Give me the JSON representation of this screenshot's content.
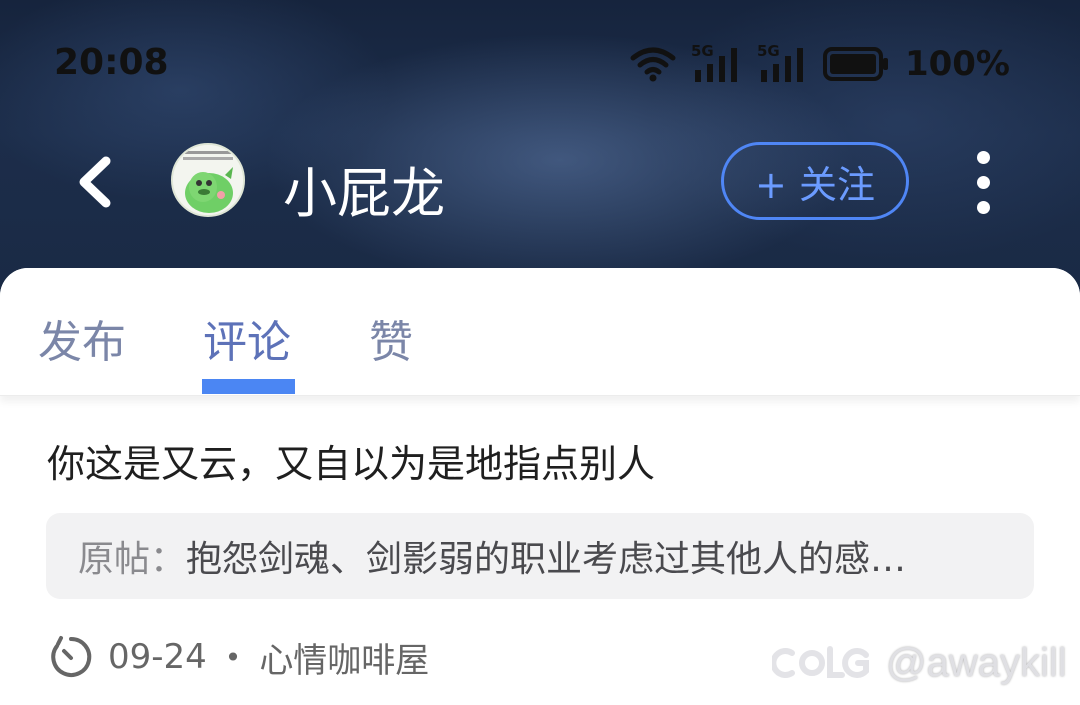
{
  "status_bar": {
    "time": "20:08",
    "network_1": "5G",
    "network_2": "5G",
    "battery": "100%"
  },
  "header": {
    "username": "小屁龙",
    "follow_label": "+ 关注"
  },
  "tabs": [
    {
      "label": "发布",
      "active": false
    },
    {
      "label": "评论",
      "active": true
    },
    {
      "label": "赞",
      "active": false
    }
  ],
  "comment": {
    "text": "你这是又云，又自以为是地指点别人",
    "quote_label": "原帖：",
    "quote_text": "抱怨剑魂、剑影弱的职业考虑过其他人的感…",
    "date": "09-24",
    "separator": "•",
    "category": "心情咖啡屋"
  },
  "watermark": {
    "handle": "@awaykill"
  },
  "colors": {
    "accent": "#4b86f3",
    "tab_active": "#5d72b8",
    "tab_inactive": "#7b86a8"
  }
}
